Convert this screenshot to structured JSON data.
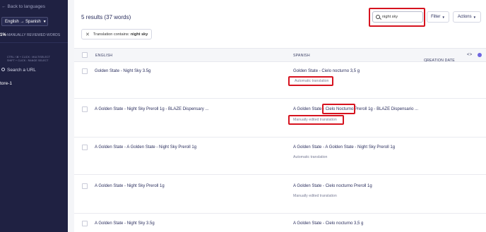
{
  "sidebar": {
    "back_label": "Back to languages",
    "language_pair": "English → Spanish",
    "reviewed_percent": "1%",
    "reviewed_label": "MANUALLY REVIEWED WORDS",
    "shortcuts_line1": "CTRL / ⌘ + CLICK : MULTISELECT",
    "shortcuts_line2": "SHIFT + CLICK : RANGE SELECT",
    "url_search_label": "Search a URL",
    "store_label": "tore-1"
  },
  "header": {
    "results_text": "5 results (37 words)",
    "filter_chip_prefix": "Translation contains:",
    "filter_chip_value": "night sky",
    "search_value": "night sky",
    "filter_button": "Filter",
    "actions_button": "Actions"
  },
  "table": {
    "columns": {
      "english": "ENGLISH",
      "spanish": "SPANISH",
      "creation_date": "CREATION DATE",
      "code_toggle": "<>"
    },
    "rows": [
      {
        "source": "Golden State - Night Sky 3.5g",
        "target": "Golden State - Cielo nocturno 3,5 g",
        "status": "Automatic translation"
      },
      {
        "source": "A Golden State - Night Sky Preroll 1g - BLAZE Dispensary ...",
        "target_before": "A Golden State - ",
        "target_highlight": "Cielo Nocturno",
        "target_after": " Preroll 1g - BLAZE Dispensario ...",
        "status": "Manually edited translation"
      },
      {
        "source": "A Golden State - A Golden State - Night Sky Preroll 1g",
        "target": "A Golden State - A Golden State - Night Sky Preroll 1g",
        "status": "Automatic translation"
      },
      {
        "source": "A Golden State - Night Sky Preroll 1g",
        "target": "A Golden State - Cielo nocturno Preroll 1g",
        "status": "Manually edited translation"
      },
      {
        "source": "A Golden State - Night Sky 3.5g",
        "target": "A Golden State - Cielo nocturno 3,5 g",
        "status": ""
      }
    ]
  },
  "colors": {
    "sidebar_bg": "#1f2142",
    "highlight_red": "#d6131f",
    "text_navy": "#2b2f5e",
    "accent_purple": "#6f66e0"
  }
}
